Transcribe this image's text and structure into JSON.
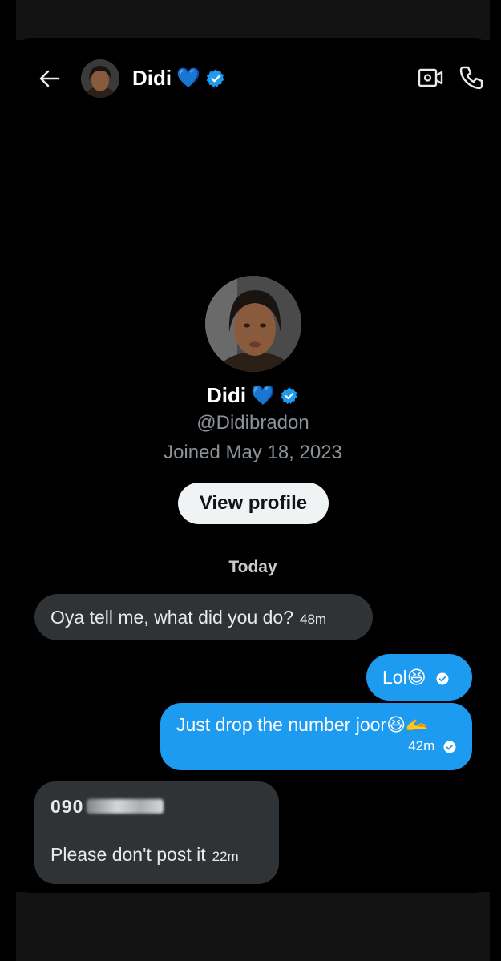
{
  "header": {
    "name": "Didi",
    "name_emoji": "💙",
    "back_icon": "arrow-left-icon",
    "video_icon": "video-call-icon",
    "call_icon": "phone-icon"
  },
  "profile": {
    "name": "Didi",
    "name_emoji": "💙",
    "handle": "@Didibradon",
    "joined": "Joined May 18, 2023",
    "view_profile_label": "View profile"
  },
  "conversation": {
    "day_label": "Today",
    "messages": [
      {
        "direction": "incoming",
        "text": "Oya tell me, what did you do?",
        "time": "48m"
      },
      {
        "direction": "outgoing",
        "text": "Lol😆",
        "time": ""
      },
      {
        "direction": "outgoing",
        "text": "Just drop the number joor😆🫴",
        "time": "42m"
      },
      {
        "direction": "incoming",
        "number_visible": "090",
        "text": "Please don't post it",
        "time": "22m"
      }
    ]
  },
  "colors": {
    "accent": "#1d9bf0",
    "incoming_bubble": "#2f3336",
    "background": "#000000",
    "verified": "#1d9bf0"
  }
}
